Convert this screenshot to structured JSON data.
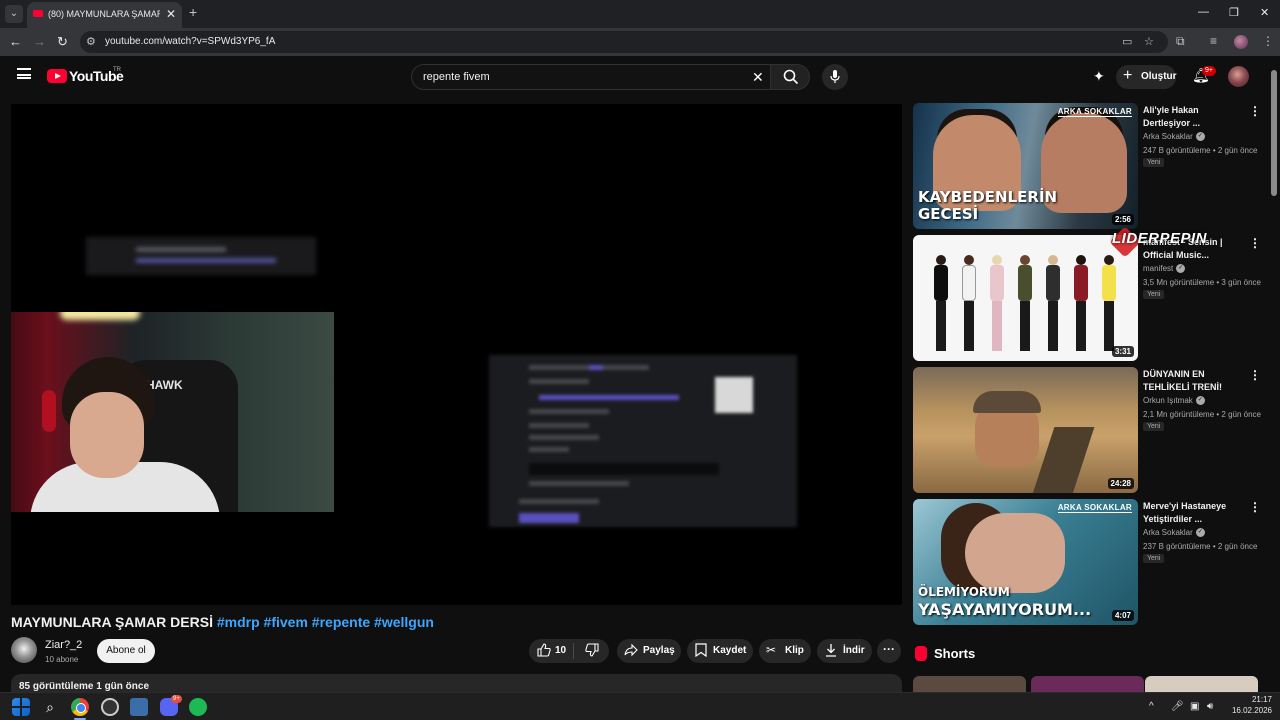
{
  "browser": {
    "tab_title": "(80) MAYMUNLARA ŞAMAR DE",
    "url": "youtube.com/watch?v=SPWd3YP6_fA"
  },
  "masthead": {
    "logo_text": "YouTube",
    "country": "TR",
    "search_value": "repente fivem",
    "create_label": "Oluştur",
    "notification_count": "9+"
  },
  "video": {
    "title_main": "MAYMUNLARA ŞAMAR DERSİ",
    "hashtags": [
      "#mdrp",
      "#fivem",
      "#repente",
      "#wellgun"
    ],
    "channel_name": "Ziar?_2",
    "subscribers": "10 abone",
    "subscribe_label": "Abone ol",
    "like_count": "10",
    "share_label": "Paylaş",
    "save_label": "Kaydet",
    "clip_label": "Klip",
    "download_label": "İndir",
    "description_stats": "85 görüntüleme  1 gün önce"
  },
  "webcam": {
    "chair_brand": "HAWK"
  },
  "recommendations": [
    {
      "title": "Ali'yle Hakan Dertleşiyor ...",
      "channel": "Arka Sokaklar",
      "verified": true,
      "meta": "247 B görüntüleme • 2 gün önce",
      "badge": "Yeni",
      "duration": "2:56",
      "thumb_text": "KAYBEDENLERİN GECESİ",
      "thumb_brand": "ARKA SOKAKLAR"
    },
    {
      "title": "manifest - Sensin | Official Music...",
      "channel": "manifest",
      "verified": true,
      "meta": "3,5 Mn görüntüleme • 3 gün önce",
      "badge": "Yeni",
      "duration": "3:31"
    },
    {
      "title": "DÜNYANIN EN TEHLİKELİ TRENİ!",
      "channel": "Orkun Işıtmak",
      "verified": true,
      "meta": "2,1 Mn görüntüleme • 2 gün önce",
      "badge": "Yeni",
      "duration": "24:28"
    },
    {
      "title": "Merve'yi Hastaneye Yetiştirdiler ...",
      "channel": "Arka Sokaklar",
      "verified": true,
      "meta": "237 B görüntüleme • 2 gün önce",
      "badge": "Yeni",
      "duration": "4:07",
      "thumb_text_small": "ÖLEMİYORUM",
      "thumb_text": "YAŞAYAMIYORUM...",
      "thumb_brand": "ARKA SOKAKLAR"
    }
  ],
  "watermark": "LIDERPEPIN",
  "shorts_label": "Shorts",
  "taskbar": {
    "discord_badge": "9+",
    "time": "21:17",
    "date": "16.02.2026"
  },
  "icons": {
    "back": "arrow-left-icon",
    "forward": "arrow-right-icon",
    "reload": "reload-icon",
    "like": "thumbs-up-icon",
    "dislike": "thumbs-down-icon",
    "share": "share-arrow-icon",
    "save": "bookmark-icon",
    "clip": "scissors-icon",
    "download": "download-icon",
    "more": "more-horizontal-icon"
  },
  "colors": {
    "youtube_red": "#ff0033",
    "link_blue": "#3ea6ff",
    "background": "#0f0f0f",
    "chip": "#272727"
  }
}
